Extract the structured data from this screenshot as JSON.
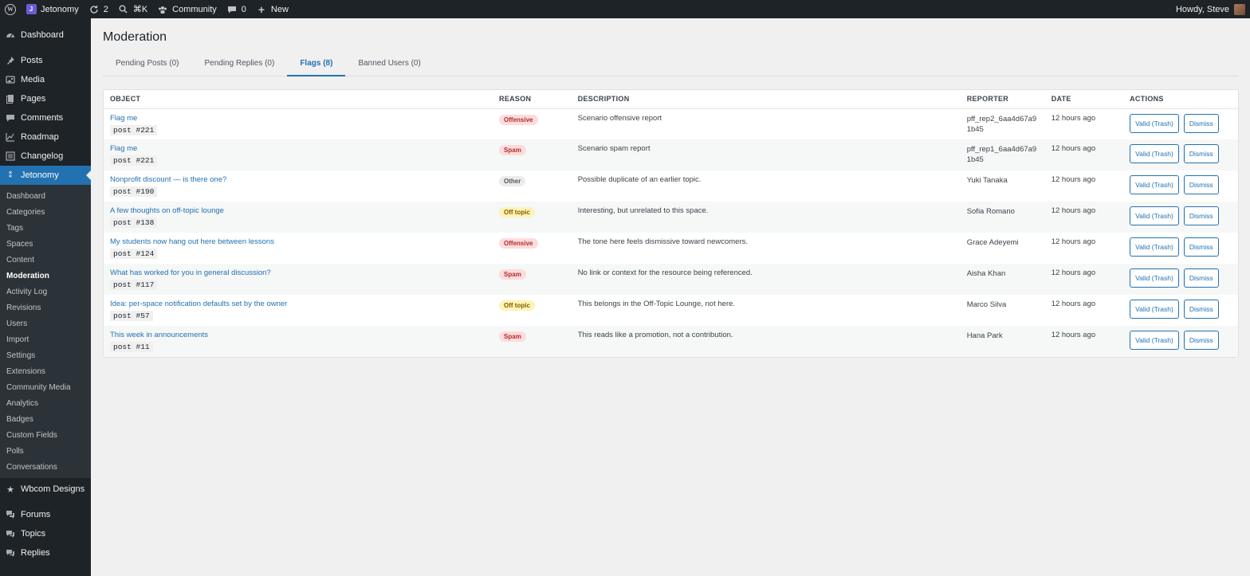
{
  "admin_bar": {
    "site_name": "Jetonomy",
    "updates_count": "2",
    "search_shortcut": "⌘K",
    "community": "Community",
    "comments_count": "0",
    "new_label": "New",
    "howdy": "Howdy, Steve"
  },
  "sidebar": {
    "top_items": [
      {
        "label": "Dashboard",
        "icon": "dashboard-icon"
      },
      {
        "label": "Posts",
        "icon": "pin-icon"
      },
      {
        "label": "Media",
        "icon": "media-icon"
      },
      {
        "label": "Pages",
        "icon": "pages-icon"
      },
      {
        "label": "Comments",
        "icon": "comments-icon"
      },
      {
        "label": "Roadmap",
        "icon": "chart-line-icon"
      },
      {
        "label": "Changelog",
        "icon": "list-icon"
      },
      {
        "label": "Jetonomy",
        "icon": "jetonomy-icon"
      }
    ],
    "submenu": [
      "Dashboard",
      "Categories",
      "Tags",
      "Spaces",
      "Content",
      "Moderation",
      "Activity Log",
      "Revisions",
      "Users",
      "Import",
      "Settings",
      "Extensions",
      "Community Media",
      "Analytics",
      "Badges",
      "Custom Fields",
      "Polls",
      "Conversations"
    ],
    "bottom_items": [
      {
        "label": "Wbcom Designs",
        "icon": "star-icon"
      },
      {
        "label": "Forums",
        "icon": "forums-icon"
      },
      {
        "label": "Topics",
        "icon": "topics-icon"
      },
      {
        "label": "Replies",
        "icon": "replies-icon"
      }
    ]
  },
  "page": {
    "title": "Moderation",
    "tabs": [
      "Pending Posts (0)",
      "Pending Replies (0)",
      "Flags (8)",
      "Banned Users (0)"
    ],
    "active_tab": "Flags (8)"
  },
  "table": {
    "headers": [
      "OBJECT",
      "REASON",
      "DESCRIPTION",
      "REPORTER",
      "DATE",
      "ACTIONS"
    ],
    "rows": [
      {
        "title": "Flag me",
        "code": "post #221",
        "reason": "Offensive",
        "reason_type": "offensive",
        "description": "Scenario offensive report",
        "reporter": "pff_rep2_6aa4d67a91b45",
        "date": "12 hours ago"
      },
      {
        "title": "Flag me",
        "code": "post #221",
        "reason": "Spam",
        "reason_type": "spam",
        "description": "Scenario spam report",
        "reporter": "pff_rep1_6aa4d67a91b45",
        "date": "12 hours ago"
      },
      {
        "title": "Nonprofit discount — is there one?",
        "code": "post #190",
        "reason": "Other",
        "reason_type": "other",
        "description": "Possible duplicate of an earlier topic.",
        "reporter": "Yuki Tanaka",
        "date": "12 hours ago"
      },
      {
        "title": "A few thoughts on off-topic lounge",
        "code": "post #138",
        "reason": "Off topic",
        "reason_type": "offtopic",
        "description": "Interesting, but unrelated to this space.",
        "reporter": "Sofia Romano",
        "date": "12 hours ago"
      },
      {
        "title": "My students now hang out here between lessons",
        "code": "post #124",
        "reason": "Offensive",
        "reason_type": "offensive",
        "description": "The tone here feels dismissive toward newcomers.",
        "reporter": "Grace Adeyemi",
        "date": "12 hours ago"
      },
      {
        "title": "What has worked for you in general discussion?",
        "code": "post #117",
        "reason": "Spam",
        "reason_type": "spam",
        "description": "No link or context for the resource being referenced.",
        "reporter": "Aisha Khan",
        "date": "12 hours ago"
      },
      {
        "title": "Idea: per-space notification defaults set by the owner",
        "code": "post #57",
        "reason": "Off topic",
        "reason_type": "offtopic",
        "description": "This belongs in the Off-Topic Lounge, not here.",
        "reporter": "Marco Silva",
        "date": "12 hours ago"
      },
      {
        "title": "This week in announcements",
        "code": "post #11",
        "reason": "Spam",
        "reason_type": "spam",
        "description": "This reads like a promotion, not a contribution.",
        "reporter": "Hana Park",
        "date": "12 hours ago"
      }
    ],
    "valid_label": "Valid (Trash)",
    "dismiss_label": "Dismiss"
  },
  "colors": {
    "accent": "#2271b1",
    "admin_dark": "#1d2327",
    "offensive_bg": "#fcdcdc",
    "offtopic_bg": "#fcf3b8"
  }
}
